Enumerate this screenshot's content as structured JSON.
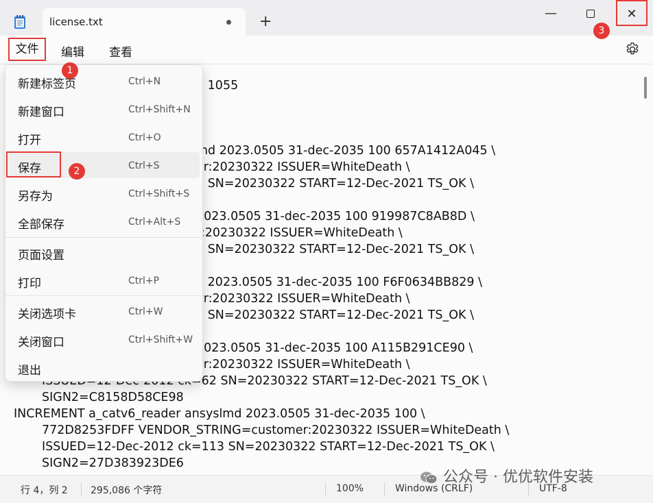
{
  "tab": {
    "title": "license.txt",
    "new_tab": "+"
  },
  "window": {
    "minimize": "—",
    "close": "✕"
  },
  "menubar": {
    "file": "文件",
    "edit": "编辑",
    "view": "查看"
  },
  "file_menu": [
    {
      "label": "新建标签页",
      "shortcut": "Ctrl+N"
    },
    {
      "label": "新建窗口",
      "shortcut": "Ctrl+Shift+N"
    },
    {
      "label": "打开",
      "shortcut": "Ctrl+O"
    },
    {
      "label": "保存",
      "shortcut": "Ctrl+S"
    },
    {
      "label": "另存为",
      "shortcut": "Ctrl+Shift+S"
    },
    {
      "label": "全部保存",
      "shortcut": "Ctrl+Alt+S"
    },
    {
      "label": "页面设置",
      "shortcut": ""
    },
    {
      "label": "打印",
      "shortcut": "Ctrl+P"
    },
    {
      "label": "关闭选项卡",
      "shortcut": "Ctrl+W"
    },
    {
      "label": "关闭窗口",
      "shortcut": "Ctrl+Shift+W"
    },
    {
      "label": "退出",
      "shortcut": ""
    }
  ],
  "badges": [
    "1",
    "2",
    "3"
  ],
  "editor_lines": [
    "d 1055",
    "md 2023.0505 31-dec-2035 100 657A1412A045 \\",
    "er:20230322 ISSUER=WhiteDeath \\",
    "5 SN=20230322 START=12-Dec-2021 TS_OK \\",
    "2023.0505 31-dec-2035 100 919987C8AB8D \\",
    "r:20230322 ISSUER=WhiteDeath \\",
    "1 SN=20230322 START=12-Dec-2021 TS_OK \\",
    "d 2023.0505 31-dec-2035 100 F6F0634BB829 \\",
    "er:20230322 ISSUER=WhiteDeath \\",
    "7 SN=20230322 START=12-Dec-2021 TS_OK \\",
    "2023.0505 31-dec-2035 100 A115B291CE90 \\",
    "er:20230322 ISSUER=WhiteDeath \\",
    "ISSUED=12-Dec-2012 ck=62 SN=20230322 START=12-Dec-2021 TS_OK \\",
    "SIGN2=C8158D58CE98",
    "INCREMENT a_catv6_reader ansyslmd 2023.0505 31-dec-2035 100 \\",
    "772D8253FDFF VENDOR_STRING=customer:20230322 ISSUER=WhiteDeath \\",
    "ISSUED=12-Dec-2012 ck=113 SN=20230322 START=12-Dec-2021 TS_OK \\",
    "SIGN2=27D383923DE6"
  ],
  "status": {
    "position": "行 4，列 2",
    "chars": "295,086 个字符",
    "zoom": "100%",
    "line_ending": "Windows (CRLF)",
    "encoding": "UTF-8"
  },
  "watermark": "公众号 · 优优软件安装",
  "colors": {
    "annotation_red": "#e53935"
  }
}
